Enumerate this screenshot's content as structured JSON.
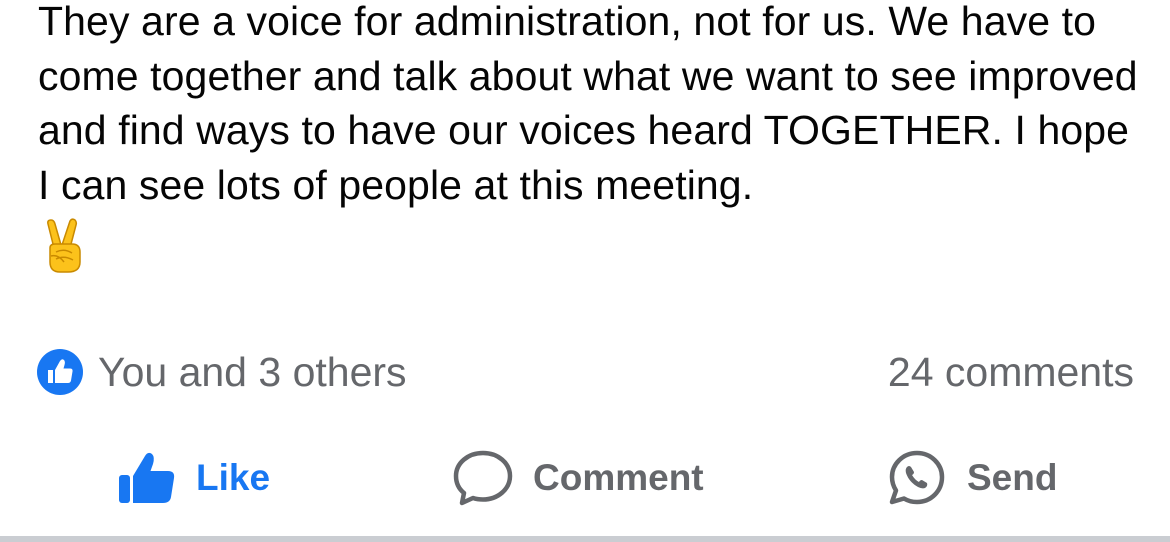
{
  "post": {
    "text": "They are a voice for administration, not for us. We have to come together and talk about what we want to see improved and find ways to have our voices heard TOGETHER. I hope I can see lots of people at this meeting.",
    "emoji": "victory-hand-emoji"
  },
  "reactions": {
    "summary": "You and 3 others",
    "icon": "like-badge-icon",
    "comments": "24 comments"
  },
  "actions": {
    "like_label": "Like",
    "comment_label": "Comment",
    "send_label": "Send"
  },
  "colors": {
    "accent": "#1877f2",
    "secondary_text": "#65676b",
    "primary_text": "#050505",
    "divider": "#cacdd2"
  }
}
